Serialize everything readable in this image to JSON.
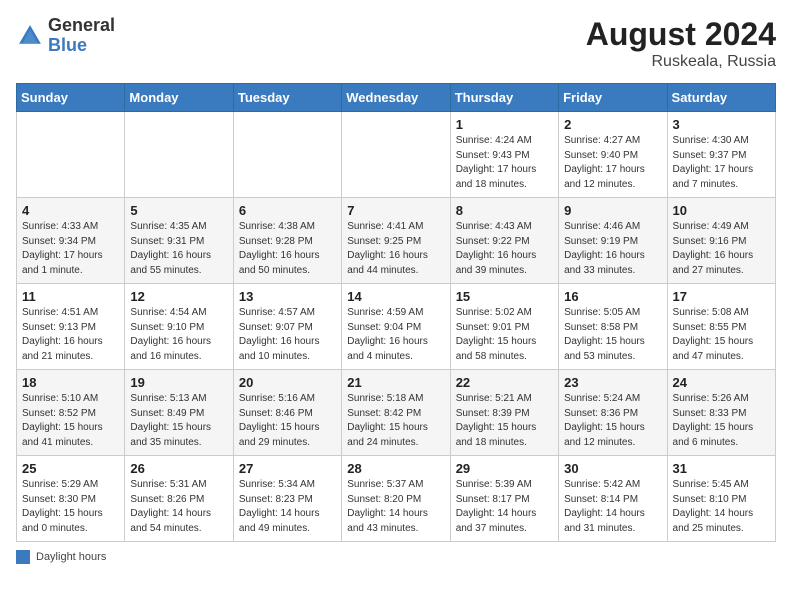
{
  "header": {
    "logo": {
      "general": "General",
      "blue": "Blue"
    },
    "title": "August 2024",
    "location": "Ruskeala, Russia"
  },
  "days_of_week": [
    "Sunday",
    "Monday",
    "Tuesday",
    "Wednesday",
    "Thursday",
    "Friday",
    "Saturday"
  ],
  "weeks": [
    [
      {
        "day": "",
        "info": ""
      },
      {
        "day": "",
        "info": ""
      },
      {
        "day": "",
        "info": ""
      },
      {
        "day": "",
        "info": ""
      },
      {
        "day": "1",
        "info": "Sunrise: 4:24 AM\nSunset: 9:43 PM\nDaylight: 17 hours\nand 18 minutes."
      },
      {
        "day": "2",
        "info": "Sunrise: 4:27 AM\nSunset: 9:40 PM\nDaylight: 17 hours\nand 12 minutes."
      },
      {
        "day": "3",
        "info": "Sunrise: 4:30 AM\nSunset: 9:37 PM\nDaylight: 17 hours\nand 7 minutes."
      }
    ],
    [
      {
        "day": "4",
        "info": "Sunrise: 4:33 AM\nSunset: 9:34 PM\nDaylight: 17 hours\nand 1 minute."
      },
      {
        "day": "5",
        "info": "Sunrise: 4:35 AM\nSunset: 9:31 PM\nDaylight: 16 hours\nand 55 minutes."
      },
      {
        "day": "6",
        "info": "Sunrise: 4:38 AM\nSunset: 9:28 PM\nDaylight: 16 hours\nand 50 minutes."
      },
      {
        "day": "7",
        "info": "Sunrise: 4:41 AM\nSunset: 9:25 PM\nDaylight: 16 hours\nand 44 minutes."
      },
      {
        "day": "8",
        "info": "Sunrise: 4:43 AM\nSunset: 9:22 PM\nDaylight: 16 hours\nand 39 minutes."
      },
      {
        "day": "9",
        "info": "Sunrise: 4:46 AM\nSunset: 9:19 PM\nDaylight: 16 hours\nand 33 minutes."
      },
      {
        "day": "10",
        "info": "Sunrise: 4:49 AM\nSunset: 9:16 PM\nDaylight: 16 hours\nand 27 minutes."
      }
    ],
    [
      {
        "day": "11",
        "info": "Sunrise: 4:51 AM\nSunset: 9:13 PM\nDaylight: 16 hours\nand 21 minutes."
      },
      {
        "day": "12",
        "info": "Sunrise: 4:54 AM\nSunset: 9:10 PM\nDaylight: 16 hours\nand 16 minutes."
      },
      {
        "day": "13",
        "info": "Sunrise: 4:57 AM\nSunset: 9:07 PM\nDaylight: 16 hours\nand 10 minutes."
      },
      {
        "day": "14",
        "info": "Sunrise: 4:59 AM\nSunset: 9:04 PM\nDaylight: 16 hours\nand 4 minutes."
      },
      {
        "day": "15",
        "info": "Sunrise: 5:02 AM\nSunset: 9:01 PM\nDaylight: 15 hours\nand 58 minutes."
      },
      {
        "day": "16",
        "info": "Sunrise: 5:05 AM\nSunset: 8:58 PM\nDaylight: 15 hours\nand 53 minutes."
      },
      {
        "day": "17",
        "info": "Sunrise: 5:08 AM\nSunset: 8:55 PM\nDaylight: 15 hours\nand 47 minutes."
      }
    ],
    [
      {
        "day": "18",
        "info": "Sunrise: 5:10 AM\nSunset: 8:52 PM\nDaylight: 15 hours\nand 41 minutes."
      },
      {
        "day": "19",
        "info": "Sunrise: 5:13 AM\nSunset: 8:49 PM\nDaylight: 15 hours\nand 35 minutes."
      },
      {
        "day": "20",
        "info": "Sunrise: 5:16 AM\nSunset: 8:46 PM\nDaylight: 15 hours\nand 29 minutes."
      },
      {
        "day": "21",
        "info": "Sunrise: 5:18 AM\nSunset: 8:42 PM\nDaylight: 15 hours\nand 24 minutes."
      },
      {
        "day": "22",
        "info": "Sunrise: 5:21 AM\nSunset: 8:39 PM\nDaylight: 15 hours\nand 18 minutes."
      },
      {
        "day": "23",
        "info": "Sunrise: 5:24 AM\nSunset: 8:36 PM\nDaylight: 15 hours\nand 12 minutes."
      },
      {
        "day": "24",
        "info": "Sunrise: 5:26 AM\nSunset: 8:33 PM\nDaylight: 15 hours\nand 6 minutes."
      }
    ],
    [
      {
        "day": "25",
        "info": "Sunrise: 5:29 AM\nSunset: 8:30 PM\nDaylight: 15 hours\nand 0 minutes."
      },
      {
        "day": "26",
        "info": "Sunrise: 5:31 AM\nSunset: 8:26 PM\nDaylight: 14 hours\nand 54 minutes."
      },
      {
        "day": "27",
        "info": "Sunrise: 5:34 AM\nSunset: 8:23 PM\nDaylight: 14 hours\nand 49 minutes."
      },
      {
        "day": "28",
        "info": "Sunrise: 5:37 AM\nSunset: 8:20 PM\nDaylight: 14 hours\nand 43 minutes."
      },
      {
        "day": "29",
        "info": "Sunrise: 5:39 AM\nSunset: 8:17 PM\nDaylight: 14 hours\nand 37 minutes."
      },
      {
        "day": "30",
        "info": "Sunrise: 5:42 AM\nSunset: 8:14 PM\nDaylight: 14 hours\nand 31 minutes."
      },
      {
        "day": "31",
        "info": "Sunrise: 5:45 AM\nSunset: 8:10 PM\nDaylight: 14 hours\nand 25 minutes."
      }
    ]
  ],
  "legend": {
    "label": "Daylight hours"
  }
}
